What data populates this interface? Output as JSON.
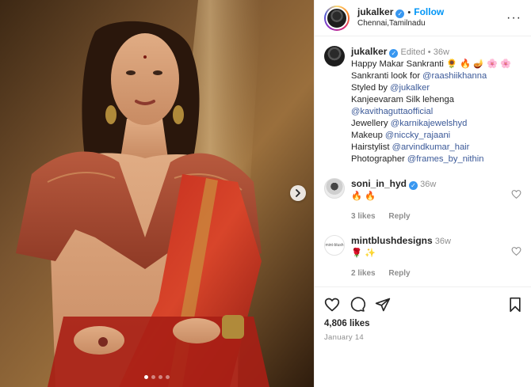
{
  "post": {
    "username": "jukalker",
    "follow_label": "Follow",
    "separator": "•",
    "location": "Chennai,Tamilnadu",
    "more_label": "···",
    "carousel_index": 1,
    "carousel_total": 4
  },
  "caption": {
    "username": "jukalker",
    "edited": "Edited",
    "dot": "•",
    "time": "36w",
    "line1": "Happy Makar Sankranti 🌻 🔥 🪔 🌸 🌸",
    "line2_prefix": "Sankranti look for ",
    "line2_mention": "@raashiikhanna",
    "line3_prefix": "Styled by ",
    "line3_mention": "@jukalker",
    "line4": "Kanjeevaram Silk lehenga",
    "line5_mention": "@kavithaguttaofficial",
    "line6_prefix": "Jewellery ",
    "line6_mention": "@karnikajewelshyd",
    "line7_prefix": "Makeup ",
    "line7_mention": "@niccky_rajaani",
    "line8_prefix": "Hairstylist ",
    "line8_mention": "@arvindkumar_hair",
    "line9_prefix": "Photographer ",
    "line9_mention": "@frames_by_nithin"
  },
  "comments": [
    {
      "username": "soni_in_hyd",
      "time": "36w",
      "text": "🔥 🔥",
      "likes": "3 likes",
      "reply": "Reply",
      "avatar_text": ""
    },
    {
      "username": "mintblushdesigns",
      "time": "36w",
      "text": "🌹 ✨",
      "likes": "2 likes",
      "reply": "Reply",
      "avatar_text": "mint-blush"
    }
  ],
  "footer": {
    "likes": "4,806 likes",
    "date": "January 14"
  },
  "colors": {
    "accent": "#0095f6",
    "verified": "#3897f0",
    "muted": "#8e8e8e"
  },
  "icons": [
    "verified-icon",
    "more-icon",
    "chevron-right-icon",
    "heart-icon",
    "comment-icon",
    "share-icon",
    "bookmark-icon"
  ]
}
